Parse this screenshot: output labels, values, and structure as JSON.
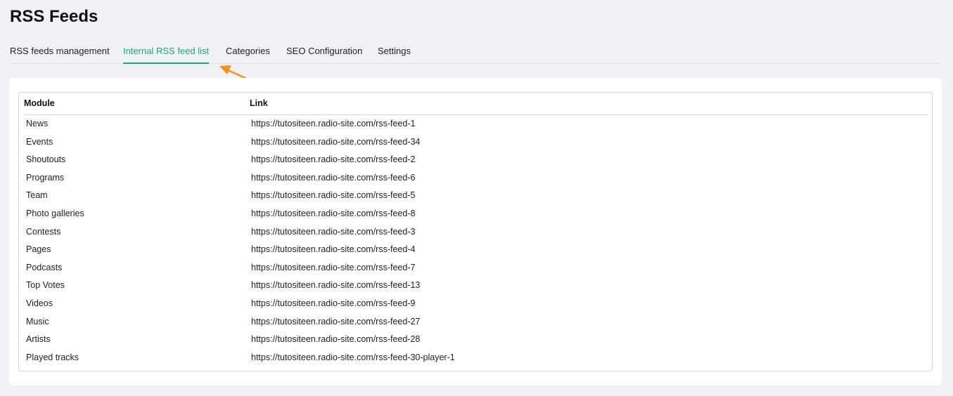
{
  "page": {
    "title": "RSS Feeds"
  },
  "tabs": [
    {
      "label": "RSS feeds management",
      "active": false
    },
    {
      "label": "Internal RSS feed list",
      "active": true
    },
    {
      "label": "Categories",
      "active": false
    },
    {
      "label": "SEO Configuration",
      "active": false
    },
    {
      "label": "Settings",
      "active": false
    }
  ],
  "colors": {
    "accent": "#1aa77a",
    "annotation_arrow": "#f5931f",
    "background": "#f1f2f6"
  },
  "table": {
    "headers": {
      "module": "Module",
      "link": "Link"
    },
    "rows": [
      {
        "module": "News",
        "link": "https://tutositeen.radio-site.com/rss-feed-1"
      },
      {
        "module": "Events",
        "link": "https://tutositeen.radio-site.com/rss-feed-34"
      },
      {
        "module": "Shoutouts",
        "link": "https://tutositeen.radio-site.com/rss-feed-2"
      },
      {
        "module": "Programs",
        "link": "https://tutositeen.radio-site.com/rss-feed-6"
      },
      {
        "module": "Team",
        "link": "https://tutositeen.radio-site.com/rss-feed-5"
      },
      {
        "module": "Photo galleries",
        "link": "https://tutositeen.radio-site.com/rss-feed-8"
      },
      {
        "module": "Contests",
        "link": "https://tutositeen.radio-site.com/rss-feed-3"
      },
      {
        "module": "Pages",
        "link": "https://tutositeen.radio-site.com/rss-feed-4"
      },
      {
        "module": "Podcasts",
        "link": "https://tutositeen.radio-site.com/rss-feed-7"
      },
      {
        "module": "Top Votes",
        "link": "https://tutositeen.radio-site.com/rss-feed-13"
      },
      {
        "module": "Videos",
        "link": "https://tutositeen.radio-site.com/rss-feed-9"
      },
      {
        "module": "Music",
        "link": "https://tutositeen.radio-site.com/rss-feed-27"
      },
      {
        "module": "Artists",
        "link": "https://tutositeen.radio-site.com/rss-feed-28"
      },
      {
        "module": "Played tracks",
        "link": "https://tutositeen.radio-site.com/rss-feed-30-player-1"
      }
    ]
  }
}
